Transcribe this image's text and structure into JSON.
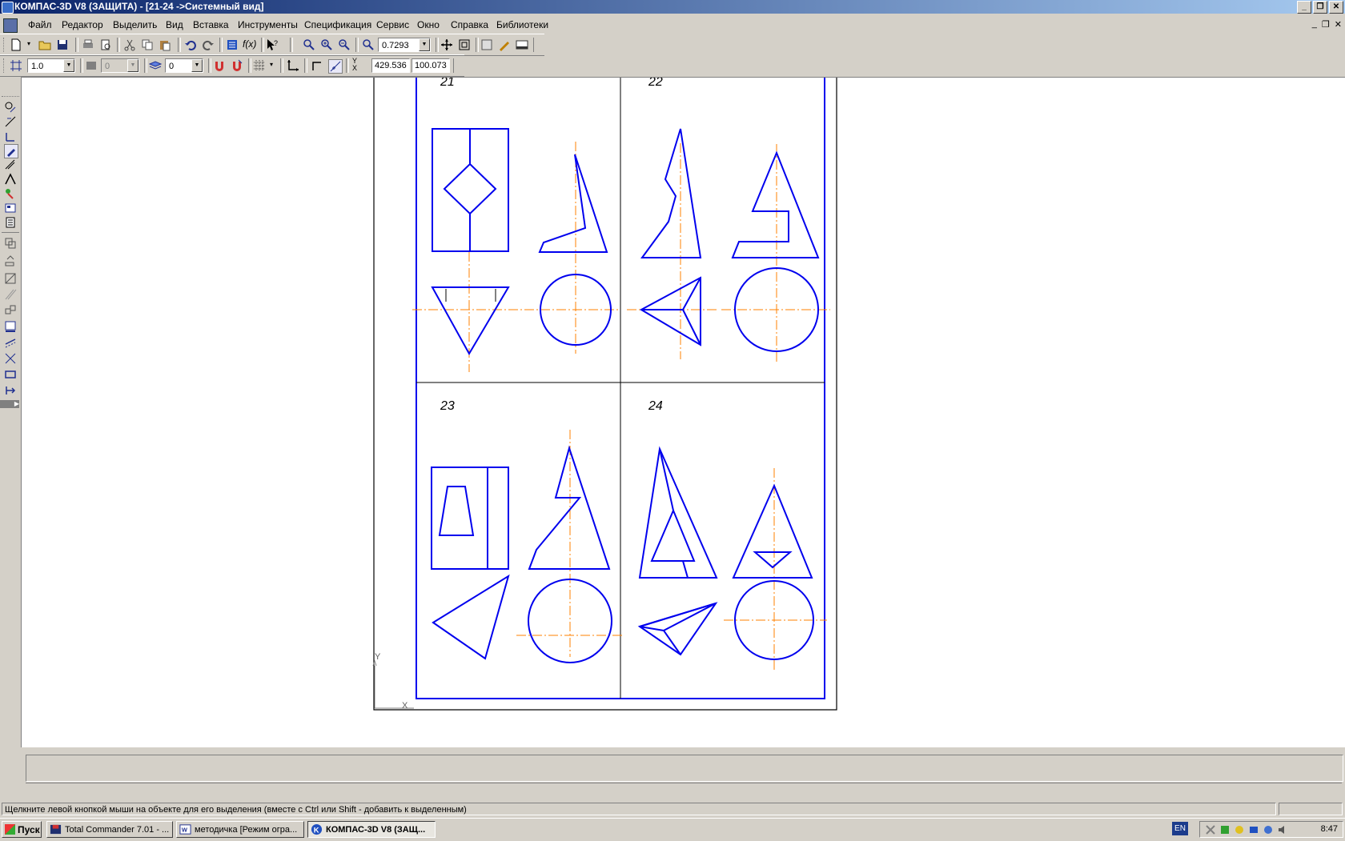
{
  "window": {
    "title": "КОМПАС-3D V8 (ЗАЩИТА) - [21-24 ->Системный вид]"
  },
  "menu": {
    "items": [
      "Файл",
      "Редактор",
      "Выделить",
      "Вид",
      "Вставка",
      "Инструменты",
      "Спецификация",
      "Сервис",
      "Окно",
      "Справка",
      "Библиотеки"
    ]
  },
  "toolbar": {
    "zoom_value": "0.7293",
    "line_scale": "1.0",
    "layer_value": "0",
    "state_value": "0",
    "coord_x": "429.536",
    "coord_y": "100.073",
    "coord_label": "Y X"
  },
  "drawing": {
    "cells": [
      {
        "number": "21"
      },
      {
        "number": "22"
      },
      {
        "number": "23"
      },
      {
        "number": "24"
      }
    ],
    "axis_labels": {
      "y": "Y",
      "x": "X"
    },
    "colors": {
      "outline": "#0000ee",
      "axis": "#ff8000",
      "frame": "#000000"
    }
  },
  "status": {
    "hint": "Щелкните левой кнопкой мыши на объекте для его выделения (вместе с Ctrl или Shift - добавить к выделенным)"
  },
  "taskbar": {
    "start": "Пуск",
    "tasks": [
      "Total Commander 7.01 - ...",
      "методичка [Режим огра...",
      "КОМПАС-3D V8 (ЗАЩ..."
    ],
    "lang": "EN",
    "clock": "8:47"
  }
}
